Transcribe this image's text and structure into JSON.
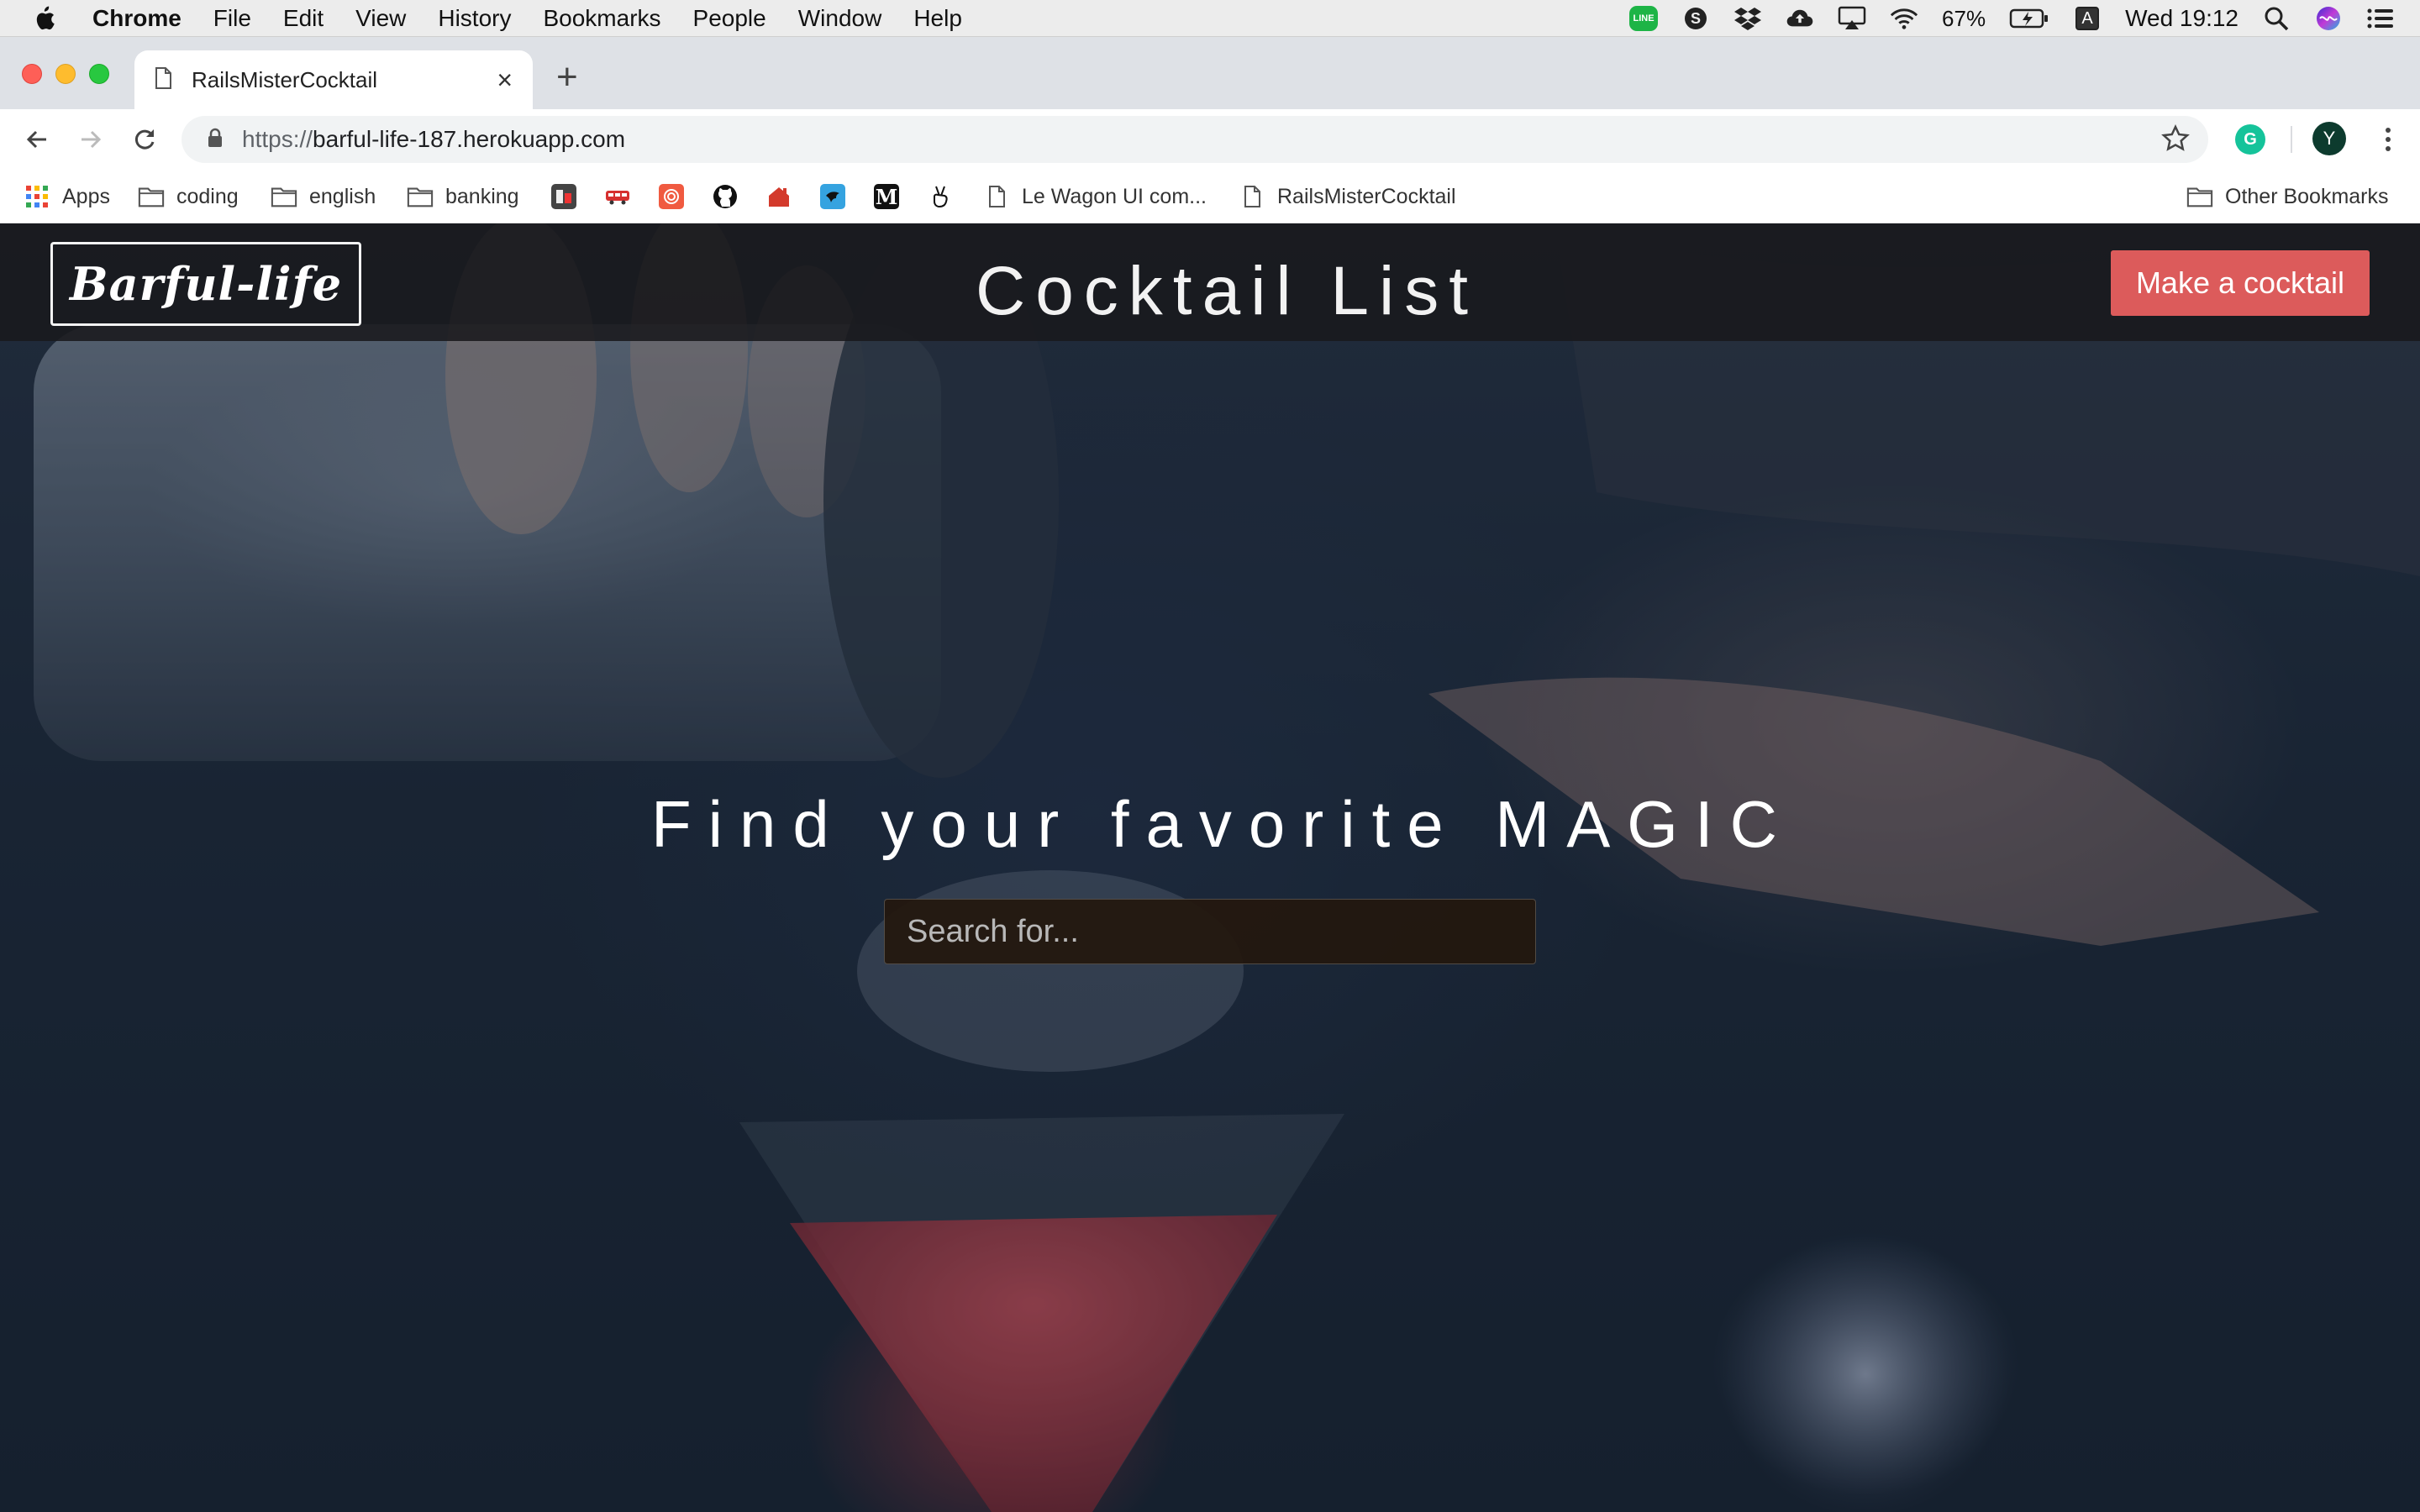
{
  "menubar": {
    "app_name": "Chrome",
    "items": [
      "File",
      "Edit",
      "View",
      "History",
      "Bookmarks",
      "People",
      "Window",
      "Help"
    ],
    "battery": "67%",
    "input_source": "A",
    "clock": "Wed 19:12",
    "line_badge": "LINE"
  },
  "browser": {
    "tab_title": "RailsMisterCocktail",
    "url_scheme": "https://",
    "url_host": "barful-life-187.herokuapp.com",
    "profile_initial": "Y",
    "extension_letter": "G"
  },
  "bookmarks": {
    "apps_label": "Apps",
    "folders": [
      "coding",
      "english",
      "banking"
    ],
    "medium_letter": "M",
    "pages": [
      "Le Wagon UI com...",
      "RailsMisterCocktail"
    ],
    "other_label": "Other Bookmarks"
  },
  "site": {
    "logo": "Barful-life",
    "title": "Cocktail List",
    "cta_label": "Make a cocktail",
    "hero_heading": "Find your favorite MAGIC",
    "search_placeholder": "Search for..."
  },
  "colors": {
    "cta": "#dc5b5b",
    "nav_background": "#19191c",
    "search_background": "#24180e",
    "hero_tint": "#1b2533"
  }
}
